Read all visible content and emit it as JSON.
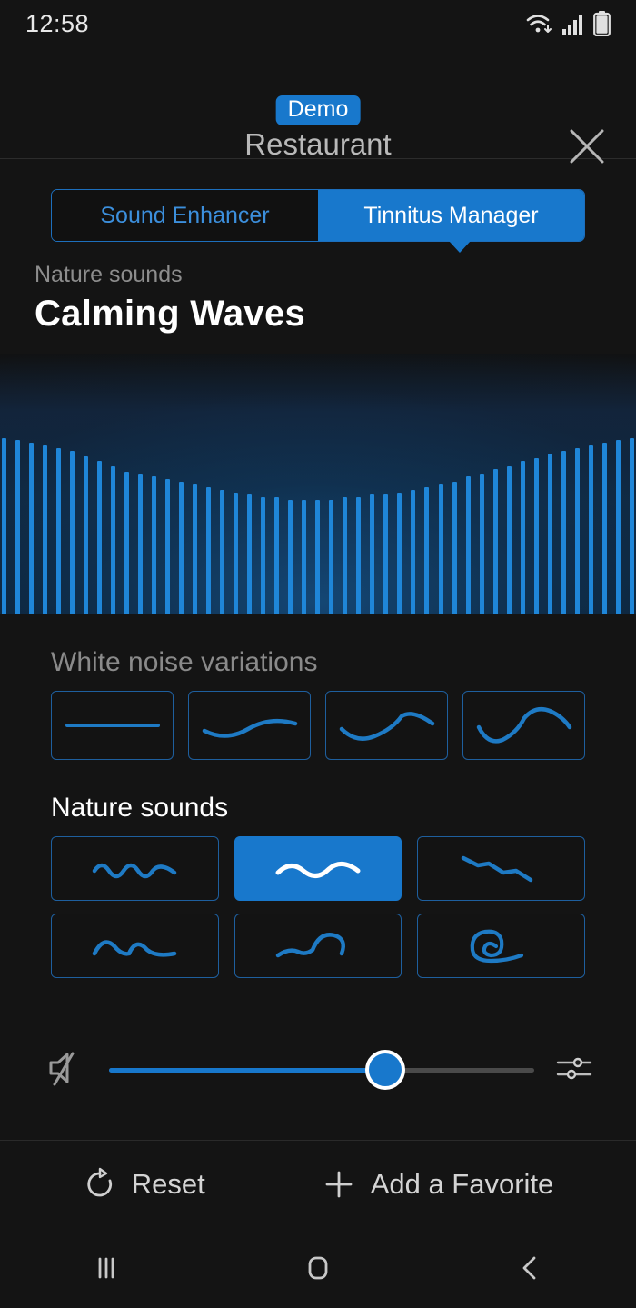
{
  "status_bar": {
    "time": "12:58",
    "icons": [
      "wifi-icon",
      "cellular-signal-icon",
      "battery-icon"
    ]
  },
  "header": {
    "badge": "Demo",
    "title": "Restaurant",
    "close_icon": "close-icon"
  },
  "tabs": [
    {
      "label": "Sound Enhancer",
      "active": false
    },
    {
      "label": "Tinnitus Manager",
      "active": true
    }
  ],
  "now_playing": {
    "category": "Nature sounds",
    "title": "Calming Waves"
  },
  "waveform": {
    "bar_color": "#1f86d8",
    "bar_count": 47,
    "heights_pct": [
      68,
      67,
      66,
      65,
      64,
      63,
      61,
      59,
      57,
      55,
      54,
      53,
      52,
      51,
      50,
      49,
      48,
      47,
      46,
      45,
      45,
      44,
      44,
      44,
      44,
      45,
      45,
      46,
      46,
      47,
      48,
      49,
      50,
      51,
      53,
      54,
      56,
      57,
      59,
      60,
      62,
      63,
      64,
      65,
      66,
      67,
      68
    ]
  },
  "white_noise": {
    "label": "White noise variations",
    "options": [
      {
        "name": "flat-line",
        "selected": false
      },
      {
        "name": "gentle-wave",
        "selected": false
      },
      {
        "name": "medium-wave",
        "selected": false
      },
      {
        "name": "steep-wave",
        "selected": false
      }
    ]
  },
  "nature_sounds": {
    "label": "Nature sounds",
    "options": [
      {
        "name": "ripple-wave",
        "selected": false
      },
      {
        "name": "smooth-wave",
        "selected": true
      },
      {
        "name": "descending-wave",
        "selected": false
      },
      {
        "name": "rolling-wave",
        "selected": false
      },
      {
        "name": "curling-wave",
        "selected": false
      },
      {
        "name": "spiral-wave",
        "selected": false
      }
    ]
  },
  "volume": {
    "mute_icon": "mute-icon",
    "settings_icon": "equalizer-icon",
    "value_pct": 65,
    "fill_color": "#1878cc"
  },
  "bottom_actions": [
    {
      "icon": "reset-icon",
      "label": "Reset"
    },
    {
      "icon": "plus-icon",
      "label": "Add a Favorite"
    }
  ],
  "nav_bar": [
    {
      "name": "recents-button"
    },
    {
      "name": "home-button"
    },
    {
      "name": "back-button"
    }
  ],
  "colors": {
    "accent": "#1878cc",
    "outline": "#1e5f9e",
    "background": "#141414"
  }
}
